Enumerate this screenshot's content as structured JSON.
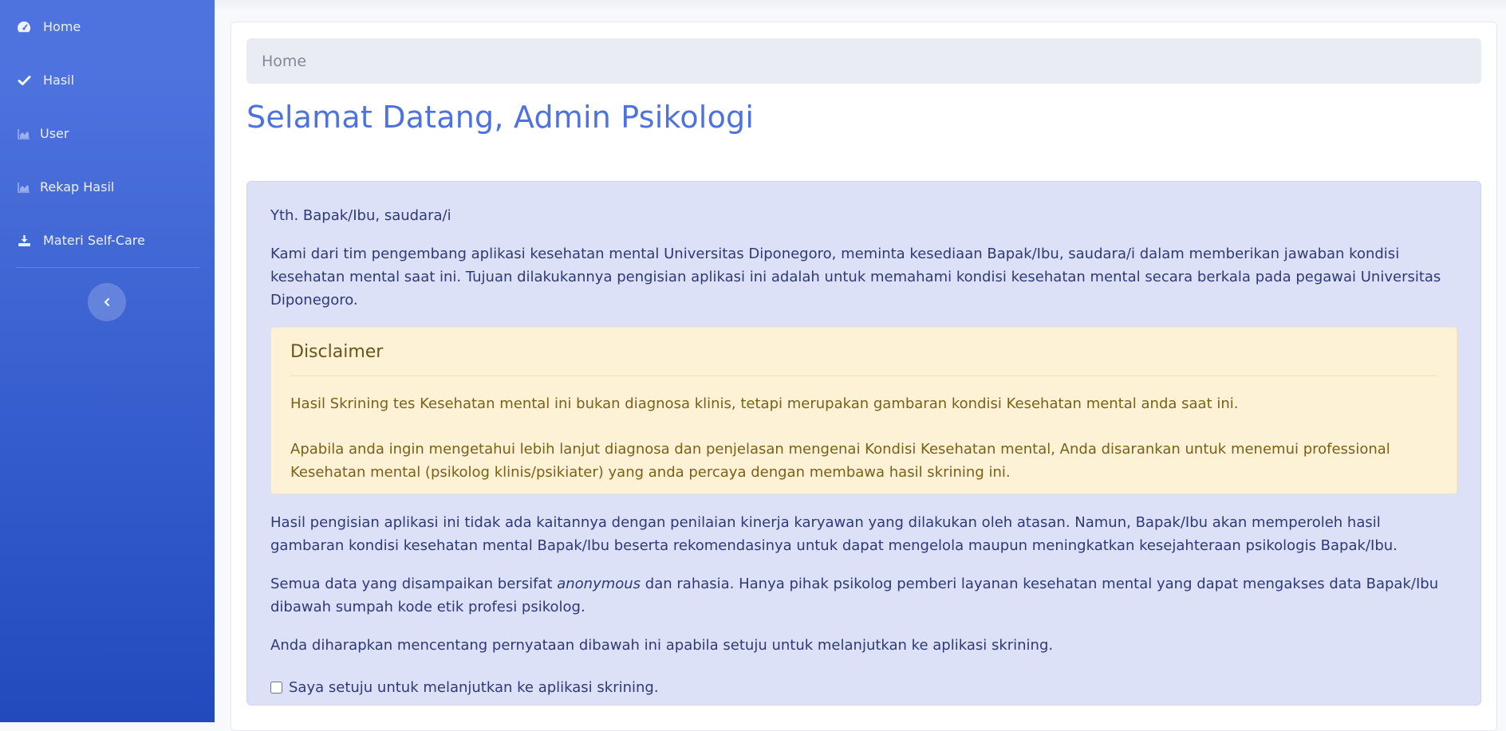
{
  "sidebar": {
    "items": [
      {
        "label": "Home",
        "icon": "gauge-icon"
      },
      {
        "label": "Hasil",
        "icon": "check-icon"
      },
      {
        "label": "User",
        "icon": "chart-area-icon"
      },
      {
        "label": "Rekap Hasil",
        "icon": "chart-area-icon"
      },
      {
        "label": "Materi Self-Care",
        "icon": "download-icon"
      }
    ],
    "toggle_icon": "chevron-left-icon"
  },
  "breadcrumb": {
    "label": "Home"
  },
  "page": {
    "title": "Selamat Datang, Admin Psikologi"
  },
  "info": {
    "greeting": "Yth. Bapak/Ibu, saudara/i",
    "intro": "Kami dari tim pengembang aplikasi kesehatan mental Universitas Diponegoro, meminta kesediaan Bapak/Ibu, saudara/i dalam memberikan jawaban kondisi kesehatan mental saat ini. Tujuan dilakukannya pengisian aplikasi ini adalah untuk memahami kondisi kesehatan mental secara berkala pada pegawai Universitas Diponegoro.",
    "disclaimer": {
      "title": "Disclaimer",
      "line1": "Hasil Skrining tes Kesehatan mental ini bukan diagnosa klinis, tetapi merupakan gambaran kondisi Kesehatan mental anda saat ini.",
      "line2": "Apabila anda ingin mengetahui lebih lanjut diagnosa dan penjelasan mengenai Kondisi Kesehatan mental, Anda disarankan untuk menemui professional Kesehatan mental (psikolog klinis/psikiater) yang anda percaya dengan membawa hasil skrining ini."
    },
    "paragraph2": "Hasil pengisian aplikasi ini tidak ada kaitannya dengan penilaian kinerja karyawan yang dilakukan oleh atasan. Namun, Bapak/Ibu akan memperoleh hasil gambaran kondisi kesehatan mental Bapak/Ibu beserta rekomendasinya untuk dapat mengelola maupun meningkatkan kesejahteraan psikologis Bapak/Ibu.",
    "paragraph3_pre": "Semua data yang disampaikan bersifat ",
    "paragraph3_em": "anonymous",
    "paragraph3_post": " dan rahasia. Hanya pihak psikolog pemberi layanan kesehatan mental yang dapat mengakses data Bapak/Ibu dibawah sumpah kode etik profesi psikolog.",
    "paragraph4": "Anda diharapkan mencentang pernyataan dibawah ini apabila setuju untuk melanjutkan ke aplikasi skrining.",
    "consent_label": "Saya setuju untuk melanjutkan ke aplikasi skrining.",
    "consent_checked": false
  },
  "colors": {
    "sidebar_top": "#4e73df",
    "sidebar_bottom": "#224abe",
    "title": "#4e73df",
    "panel_bg": "#dce1f8",
    "disclaimer_bg": "#fdf2d6"
  }
}
